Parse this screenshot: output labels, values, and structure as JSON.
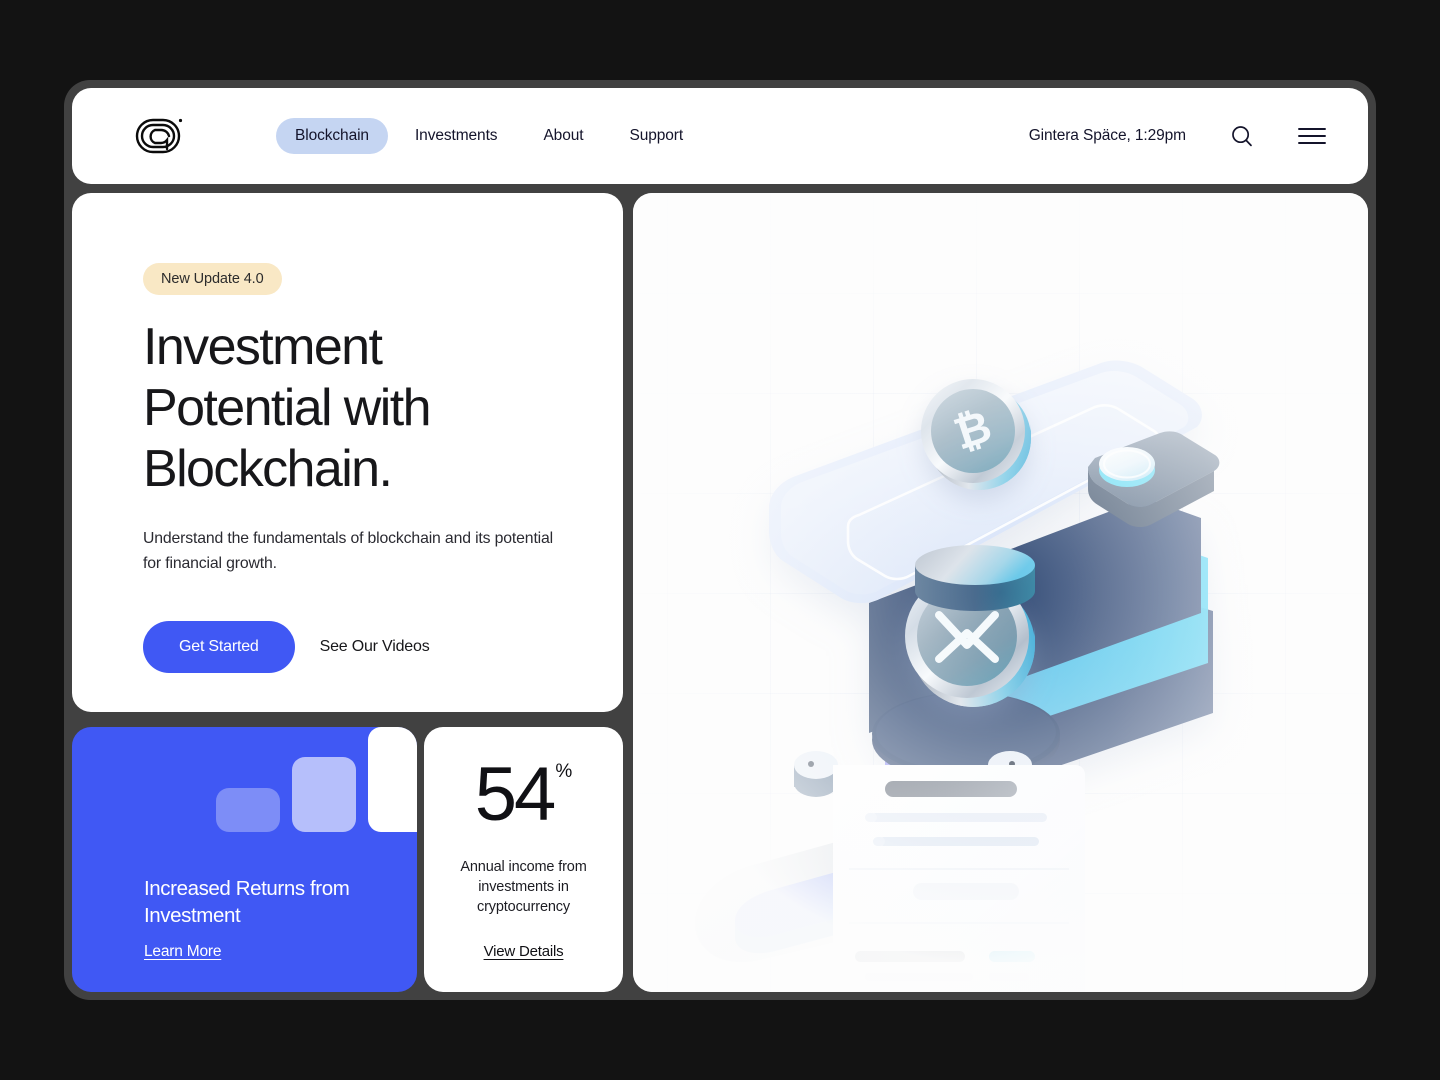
{
  "window": {
    "background_color": "#131313",
    "frame_color": "#414141"
  },
  "header": {
    "logo_name": "gintera-logo",
    "nav": [
      {
        "label": "Blockchain",
        "active": true
      },
      {
        "label": "Investments",
        "active": false
      },
      {
        "label": "About",
        "active": false
      },
      {
        "label": "Support",
        "active": false
      }
    ],
    "status": "Gintera Späce, 1:29pm",
    "search_icon": "search-icon",
    "menu_icon": "hamburger-menu-icon"
  },
  "hero": {
    "badge": "New Update 4.0",
    "title_line_1": "Investment",
    "title_line_2": "Potential with",
    "title_line_3": "Blockchain.",
    "subtitle": "Understand the fundamentals of blockchain and its potential for financial growth.",
    "primary_button": "Get Started",
    "secondary_button": "See Our Videos"
  },
  "returns_card": {
    "title": "Increased Returns from Investment",
    "link": "Learn More",
    "background_color": "#4058f4",
    "chart_bars": [
      44,
      75,
      105
    ]
  },
  "stat_card": {
    "value": "54",
    "unit": "%",
    "description": "Annual income from investments in cryptocurrency",
    "link": "View Details"
  },
  "illustration": {
    "name": "crypto-wallet-3d-illustration",
    "coins": [
      {
        "symbol": "₿",
        "name": "bitcoin-coin"
      },
      {
        "symbol": "",
        "name": "blank-coin-edge"
      },
      {
        "symbol": "X",
        "name": "xrp-coin"
      }
    ],
    "object": "wallet-with-receipt",
    "accent_color": "#4058f4"
  },
  "colors": {
    "accent_blue": "#4058f4",
    "pill_blue": "#c5d5f2",
    "badge_cream": "#f9e8c5",
    "text_dark": "#17171a"
  }
}
